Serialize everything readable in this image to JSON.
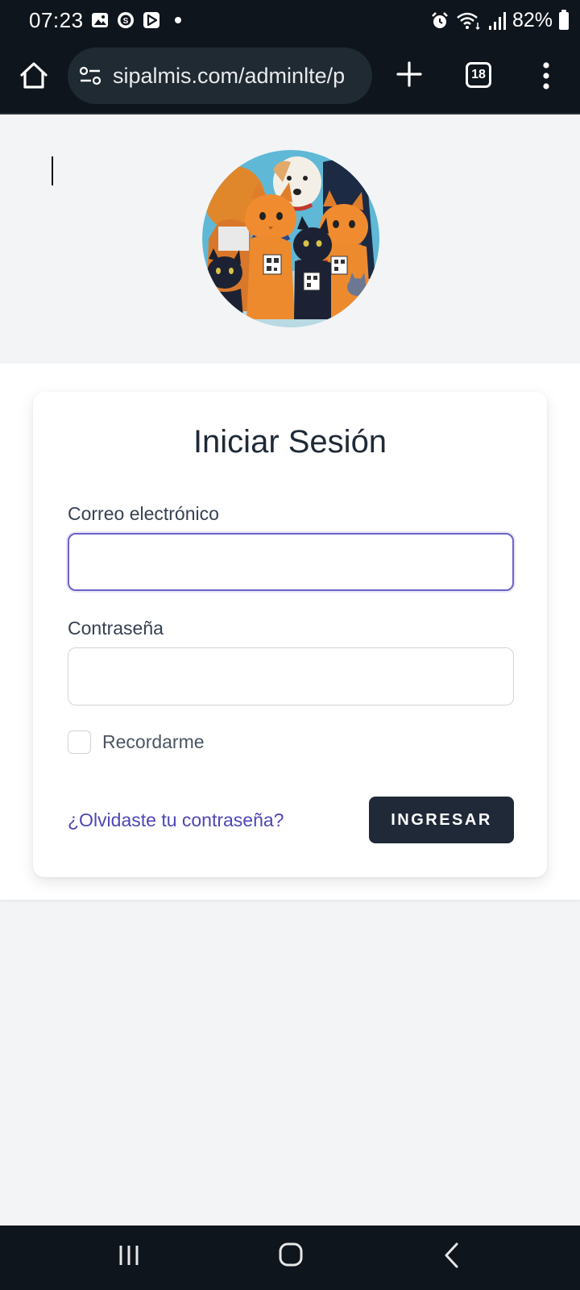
{
  "status_bar": {
    "time": "07:23",
    "battery": "82%",
    "icons": [
      "gallery-icon",
      "s-app-icon",
      "play-store-icon",
      "notification-dot",
      "alarm-icon",
      "wifi-icon",
      "signal-icon",
      "battery-icon"
    ]
  },
  "browser": {
    "url": "sipalmis.com/adminlte/p",
    "tab_count": "18",
    "icons": [
      "home-icon",
      "site-settings-icon",
      "new-tab-icon",
      "tabs-icon",
      "menu-icon"
    ]
  },
  "login": {
    "title": "Iniciar Sesión",
    "email_label": "Correo electrónico",
    "email_value": "",
    "password_label": "Contraseña",
    "password_value": "",
    "remember_label": "Recordarme",
    "remember_checked": false,
    "forgot_link": "¿Olvidaste tu contraseña?",
    "submit_label": "INGRESAR"
  },
  "colors": {
    "accent": "#6d62c9",
    "link": "#4f46b5",
    "button": "#1f2937",
    "system_bar": "#0f151d",
    "page_bg": "#f3f4f6"
  },
  "nav_bar": {
    "icons": [
      "recent-apps-icon",
      "home-nav-icon",
      "back-icon"
    ]
  }
}
